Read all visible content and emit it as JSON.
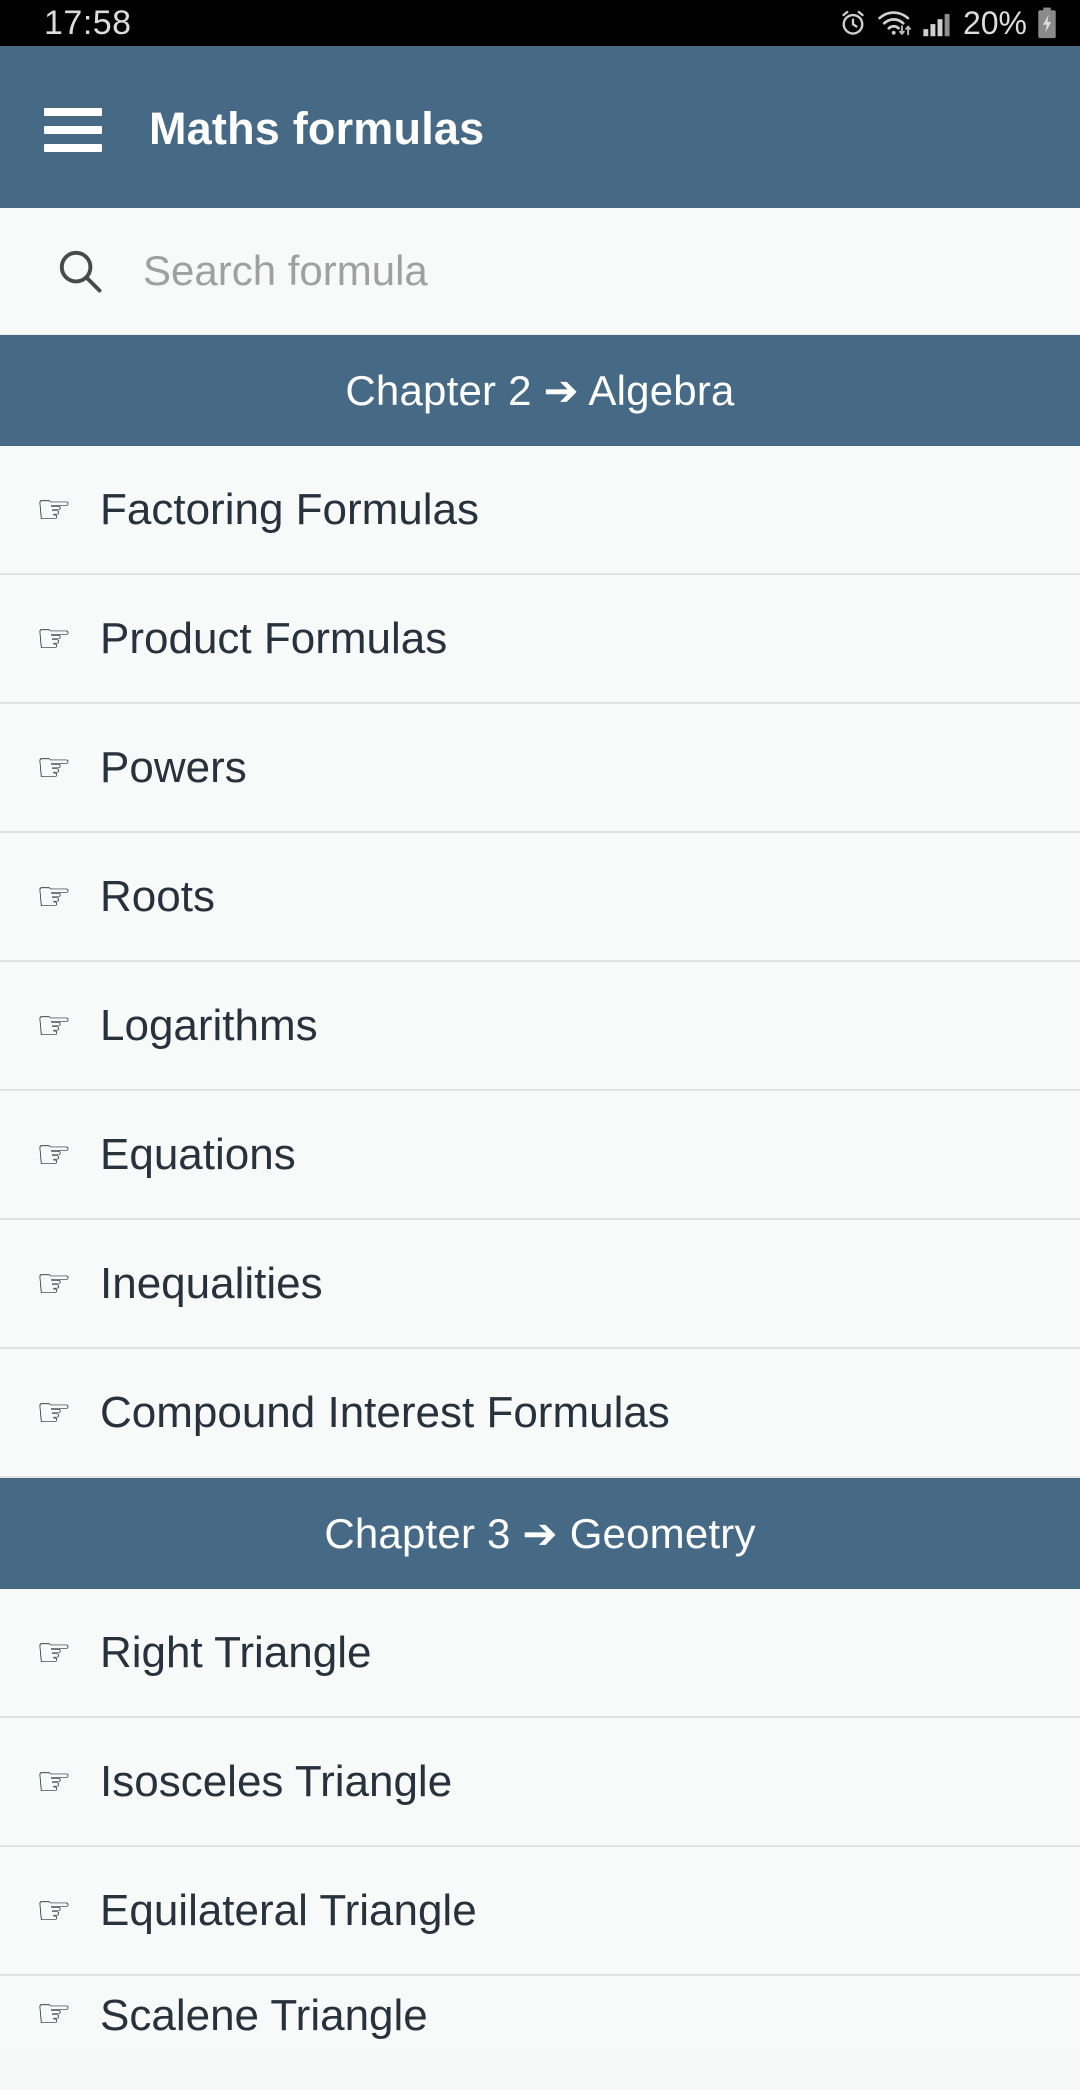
{
  "status_bar": {
    "time": "17:58",
    "battery_percent": "20%",
    "icons": [
      "alarm-icon",
      "wifi-icon",
      "signal-bars-icon",
      "battery-charging-icon"
    ]
  },
  "app_bar": {
    "menu_icon": "hamburger-menu-icon",
    "title": "Maths formulas",
    "background_color": "#466a85"
  },
  "search": {
    "icon": "search-icon",
    "placeholder": "Search formula",
    "value": ""
  },
  "sections": [
    {
      "header": "Chapter 2 ➔ Algebra",
      "items": [
        {
          "icon": "pointing-hand-icon",
          "label": "Factoring Formulas"
        },
        {
          "icon": "pointing-hand-icon",
          "label": "Product Formulas"
        },
        {
          "icon": "pointing-hand-icon",
          "label": "Powers"
        },
        {
          "icon": "pointing-hand-icon",
          "label": "Roots"
        },
        {
          "icon": "pointing-hand-icon",
          "label": "Logarithms"
        },
        {
          "icon": "pointing-hand-icon",
          "label": "Equations"
        },
        {
          "icon": "pointing-hand-icon",
          "label": "Inequalities"
        },
        {
          "icon": "pointing-hand-icon",
          "label": "Compound Interest Formulas"
        }
      ]
    },
    {
      "header": "Chapter 3 ➔ Geometry",
      "items": [
        {
          "icon": "pointing-hand-icon",
          "label": "Right Triangle"
        },
        {
          "icon": "pointing-hand-icon",
          "label": "Isosceles Triangle"
        },
        {
          "icon": "pointing-hand-icon",
          "label": "Equilateral Triangle"
        },
        {
          "icon": "pointing-hand-icon",
          "label": "Scalene Triangle"
        }
      ]
    }
  ],
  "colors": {
    "accent": "#466a85",
    "list_background": "#f8f9f9",
    "text": "#27323d",
    "divider": "#e2e2e2",
    "placeholder": "#a0a0a0"
  }
}
